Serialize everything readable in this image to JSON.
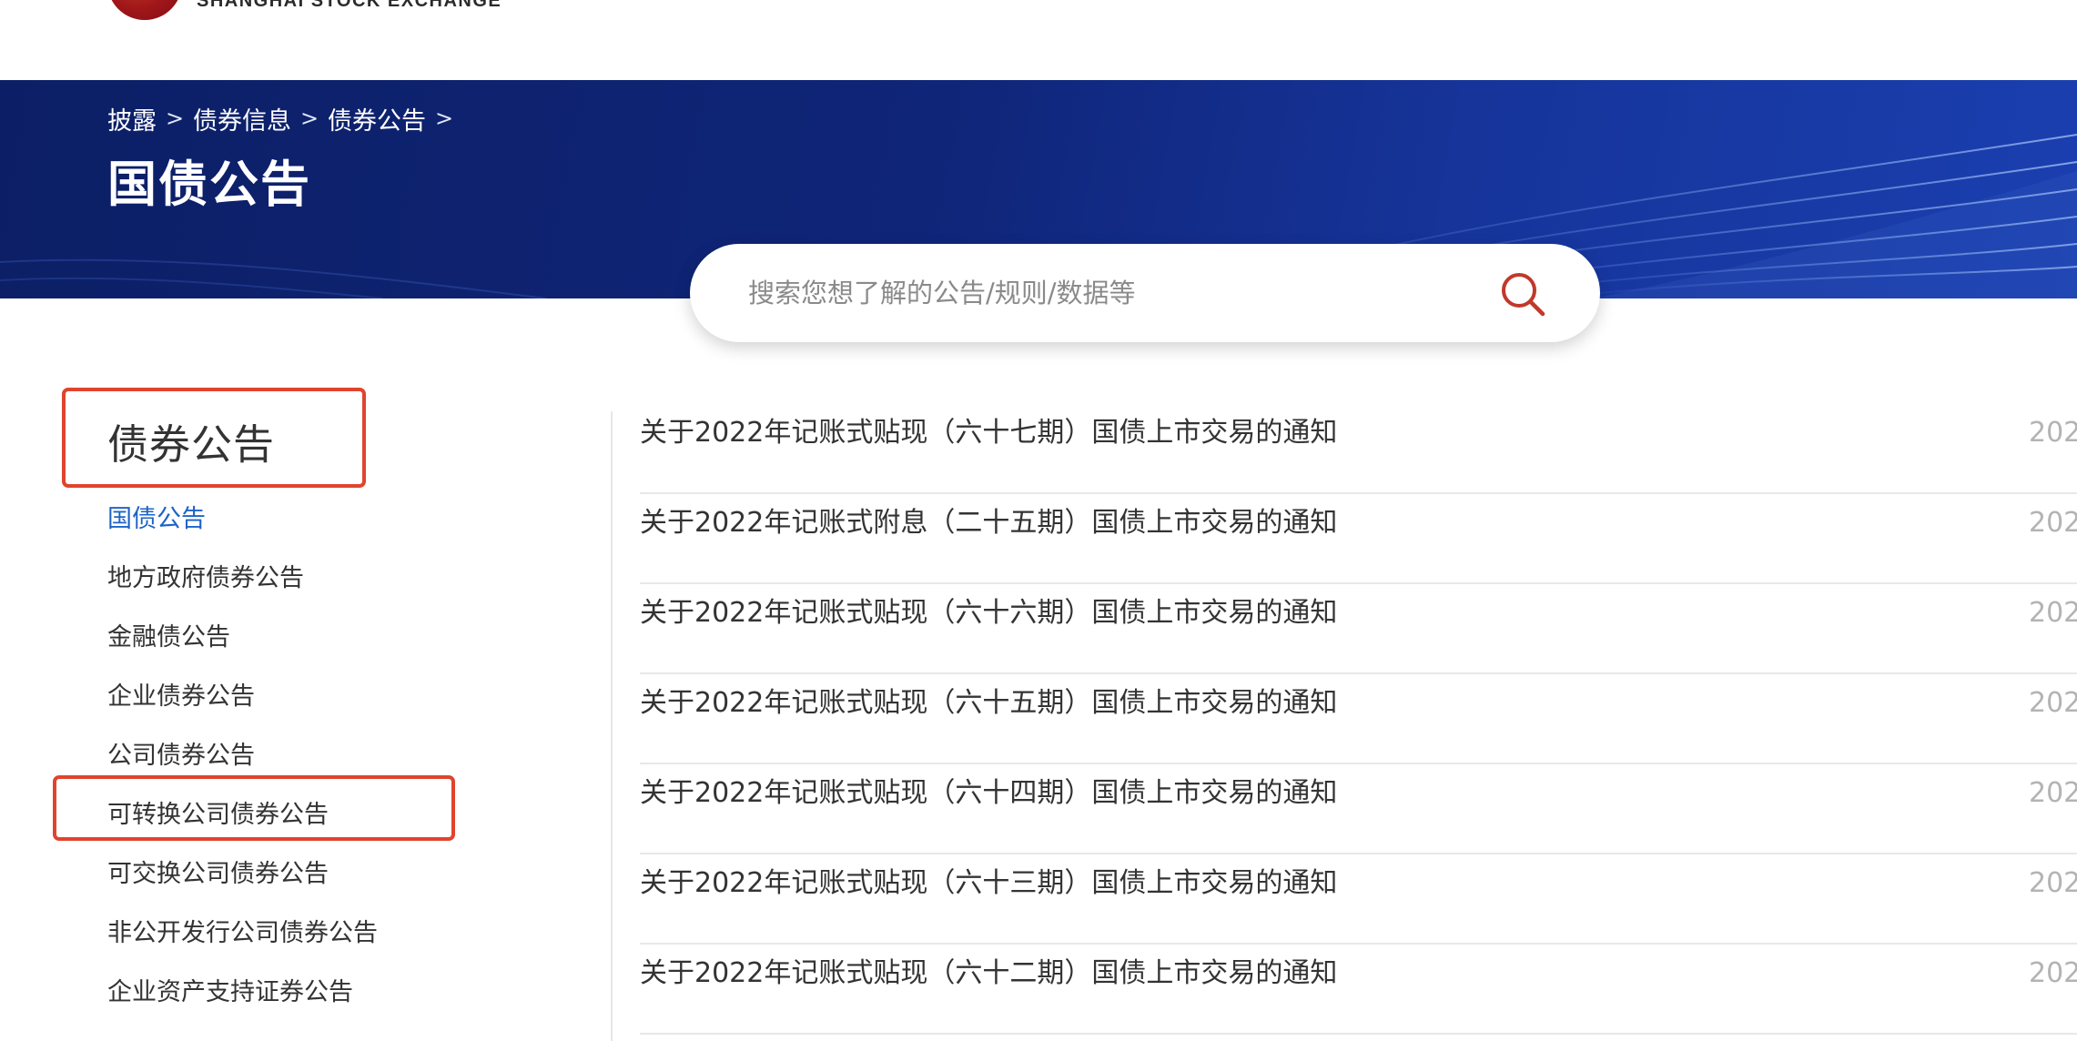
{
  "header": {
    "logo_en": "SHANGHAI STOCK EXCHANGE"
  },
  "banner": {
    "breadcrumb": [
      "披露",
      "债券信息",
      "债券公告"
    ],
    "breadcrumb_separator": ">",
    "title": "国债公告"
  },
  "search": {
    "placeholder": "搜索您想了解的公告/规则/数据等"
  },
  "sidebar": {
    "title": "债券公告",
    "items": [
      {
        "label": "国债公告",
        "active": true
      },
      {
        "label": "地方政府债券公告",
        "active": false
      },
      {
        "label": "金融债公告",
        "active": false
      },
      {
        "label": "企业债券公告",
        "active": false
      },
      {
        "label": "公司债券公告",
        "active": false
      },
      {
        "label": "可转换公司债券公告",
        "active": false
      },
      {
        "label": "可交换公司债券公告",
        "active": false
      },
      {
        "label": "非公开发行公司债券公告",
        "active": false
      },
      {
        "label": "企业资产支持证券公告",
        "active": false
      }
    ]
  },
  "notices": [
    {
      "title": "关于2022年记账式贴现（六十七期）国债上市交易的通知",
      "date": "202"
    },
    {
      "title": "关于2022年记账式附息（二十五期）国债上市交易的通知",
      "date": "202"
    },
    {
      "title": "关于2022年记账式贴现（六十六期）国债上市交易的通知",
      "date": "202"
    },
    {
      "title": "关于2022年记账式贴现（六十五期）国债上市交易的通知",
      "date": "202"
    },
    {
      "title": "关于2022年记账式贴现（六十四期）国债上市交易的通知",
      "date": "202"
    },
    {
      "title": "关于2022年记账式贴现（六十三期）国债上市交易的通知",
      "date": "202"
    },
    {
      "title": "关于2022年记账式贴现（六十二期）国债上市交易的通知",
      "date": "202"
    }
  ],
  "colors": {
    "banner_blue": "#0f2578",
    "active_link": "#1d63c7",
    "search_icon": "#c0392b",
    "highlight_border": "#e0442d",
    "date_gray": "#b3b3b3"
  }
}
